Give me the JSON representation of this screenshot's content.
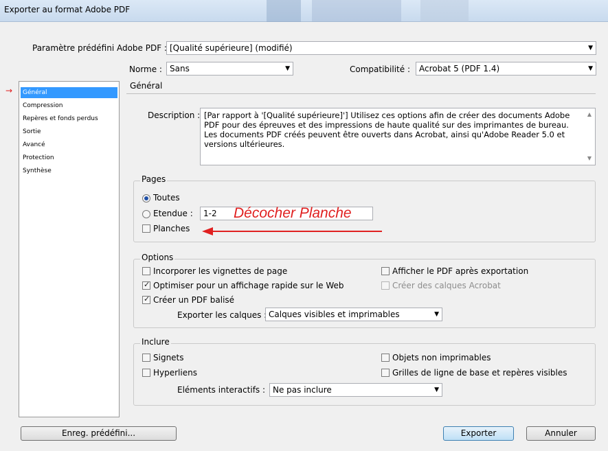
{
  "window": {
    "title": "Exporter au format Adobe PDF"
  },
  "preset": {
    "label": "Paramètre prédéfini Adobe PDF :",
    "value": "[Qualité supérieure] (modifié)"
  },
  "norme": {
    "label": "Norme :",
    "value": "Sans"
  },
  "compat": {
    "label": "Compatibilité :",
    "value": "Acrobat 5 (PDF 1.4)"
  },
  "sidebar": {
    "items": [
      {
        "label": "Général",
        "selected": true
      },
      {
        "label": "Compression"
      },
      {
        "label": "Repères et fonds perdus"
      },
      {
        "label": "Sortie"
      },
      {
        "label": "Avancé"
      },
      {
        "label": "Protection"
      },
      {
        "label": "Synthèse"
      }
    ]
  },
  "general": {
    "title": "Général",
    "description_label": "Description :",
    "description_text": "[Par rapport à '[Qualité supérieure]'] Utilisez ces options afin de créer des documents Adobe PDF pour des épreuves et des impressions de haute qualité sur des imprimantes de bureau. Les documents PDF créés peuvent être ouverts dans Acrobat, ainsi qu'Adobe Reader 5.0 et versions ultérieures."
  },
  "pages": {
    "title": "Pages",
    "toutes": "Toutes",
    "etendue": "Etendue :",
    "etendue_value": "1-2",
    "planches": "Planches"
  },
  "annotation": {
    "text": "Décocher Planche"
  },
  "options": {
    "title": "Options",
    "vignettes": "Incorporer les vignettes de page",
    "optimiser": "Optimiser pour un affichage rapide sur le Web",
    "balise": "Créer un PDF balisé",
    "afficher": "Afficher le PDF après exportation",
    "calques_acrobat": "Créer des calques Acrobat",
    "exporter_calques_label": "Exporter les calques :",
    "exporter_calques_value": "Calques visibles et imprimables"
  },
  "inclure": {
    "title": "Inclure",
    "signets": "Signets",
    "hyperliens": "Hyperliens",
    "objets": "Objets non imprimables",
    "grilles": "Grilles de ligne de base et repères visibles",
    "interactifs_label": "Eléments interactifs :",
    "interactifs_value": "Ne pas inclure"
  },
  "buttons": {
    "enreg": "Enreg. prédéfini...",
    "exporter": "Exporter",
    "annuler": "Annuler"
  },
  "colors": {
    "accent": "#3399ff",
    "annotation": "#e02020"
  }
}
